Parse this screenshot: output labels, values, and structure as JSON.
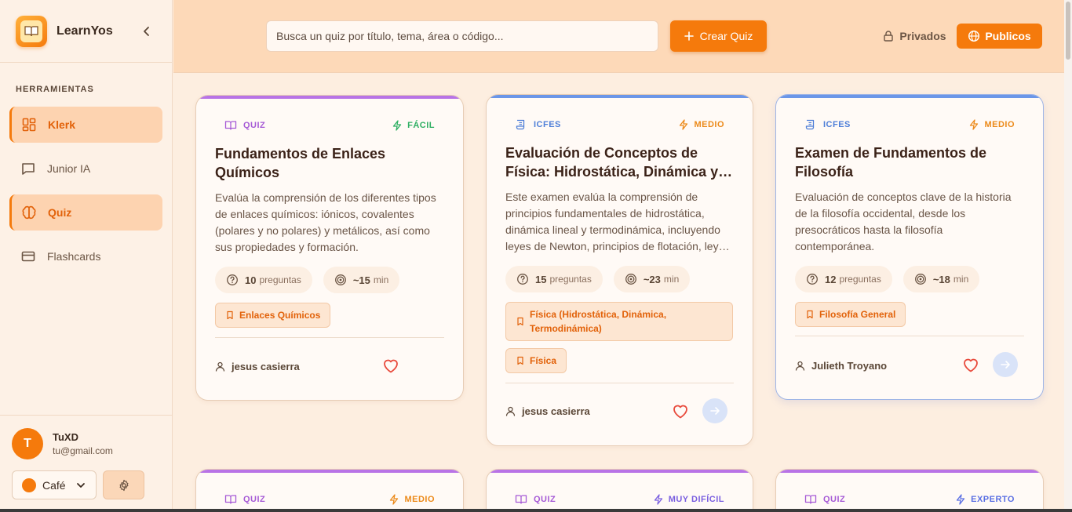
{
  "app": {
    "name": "LearnYos"
  },
  "sidebar": {
    "section_title": "HERRAMIENTAS",
    "items": [
      {
        "label": "Klerk",
        "icon": "dashboard-icon",
        "active": true
      },
      {
        "label": "Junior IA",
        "icon": "chat-icon",
        "active": false
      },
      {
        "label": "Quiz",
        "icon": "brain-icon",
        "active": true
      },
      {
        "label": "Flashcards",
        "icon": "card-icon",
        "active": false
      }
    ],
    "user": {
      "initial": "T",
      "name": "TuXD",
      "email": "tu@gmail.com"
    },
    "theme": {
      "label": "Café",
      "color": "#f57a0c"
    }
  },
  "header": {
    "search_placeholder": "Busca un quiz por título, tema, área o código...",
    "create_label": "Crear Quiz",
    "private_label": "Privados",
    "public_label": "Publicos"
  },
  "colors": {
    "accent": "#f57a0c",
    "quiz_bar": "#b873e6",
    "icfes_bar": "#6b96e8"
  },
  "cards": [
    {
      "type": "QUIZ",
      "level": "FÁCIL",
      "title": "Fundamentos de Enlaces Químicos",
      "description": "Evalúa la comprensión de los diferentes tipos de enlaces químicos: iónicos, covalentes (polares y no polares) y metálicos, así como sus propiedades y formación.",
      "questions": "10",
      "questions_label": "preguntas",
      "time": "~15",
      "time_label": "min",
      "tags": [
        "Enlaces Químicos"
      ],
      "author": "jesus casierra"
    },
    {
      "type": "ICFES",
      "level": "MEDIO",
      "title": "Evaluación de Conceptos de Física: Hidrostática, Dinámica y Termodinámica",
      "description": "Este examen evalúa la comprensión de principios fundamentales de hidrostática, dinámica lineal y termodinámica, incluyendo leyes de Newton, principios de flotación, leyes de los gases y más.",
      "questions": "15",
      "questions_label": "preguntas",
      "time": "~23",
      "time_label": "min",
      "tags": [
        "Física (Hidrostática, Dinámica, Termodinámica)",
        "Física"
      ],
      "author": "jesus casierra"
    },
    {
      "type": "ICFES",
      "level": "MEDIO",
      "title": "Examen de Fundamentos de Filosofía",
      "description": "Evaluación de conceptos clave de la historia de la filosofía occidental, desde los presocráticos hasta la filosofía contemporánea.",
      "questions": "12",
      "questions_label": "preguntas",
      "time": "~18",
      "time_label": "min",
      "tags": [
        "Filosofía General"
      ],
      "author": "Julieth Troyano"
    },
    {
      "type": "QUIZ",
      "level": "MEDIO"
    },
    {
      "type": "QUIZ",
      "level": "MUY DIFÍCIL"
    },
    {
      "type": "QUIZ",
      "level": "EXPERTO"
    }
  ]
}
